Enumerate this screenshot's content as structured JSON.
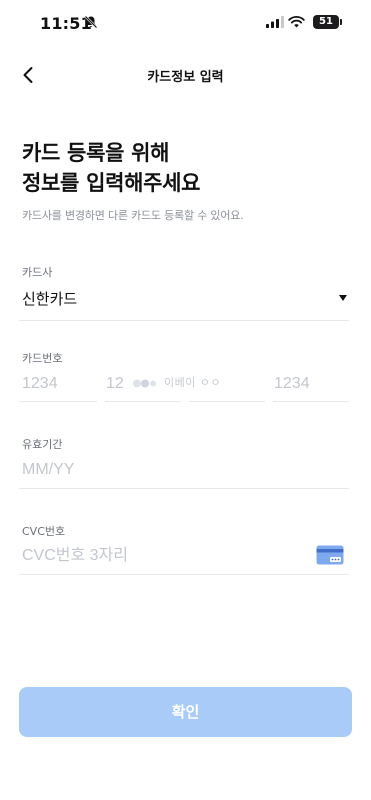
{
  "status_bar": {
    "time": "11:51",
    "battery": "51"
  },
  "nav": {
    "title": "카드정보 입력"
  },
  "headline": {
    "line1": "카드 등록을 위해",
    "line2": "정보를 입력해주세요"
  },
  "subtitle": "카드사를 변경하면 다른 카드도 등록할 수 있어요.",
  "card_company": {
    "label": "카드사",
    "value": "신한카드"
  },
  "card_number": {
    "label": "카드번호",
    "placeholders": [
      "1234",
      "12",
      "",
      "1234"
    ]
  },
  "watermark": "이베이 ㅇㅇ",
  "expiry": {
    "label": "유효기간",
    "placeholder": "MM/YY"
  },
  "cvc": {
    "label": "CVC번호",
    "placeholder": "CVC번호 3자리"
  },
  "confirm_button": {
    "label": "확인"
  },
  "colors": {
    "button_bg": "#a9cbf8",
    "accent": "#5b8def",
    "placeholder": "#c3c7cd"
  }
}
